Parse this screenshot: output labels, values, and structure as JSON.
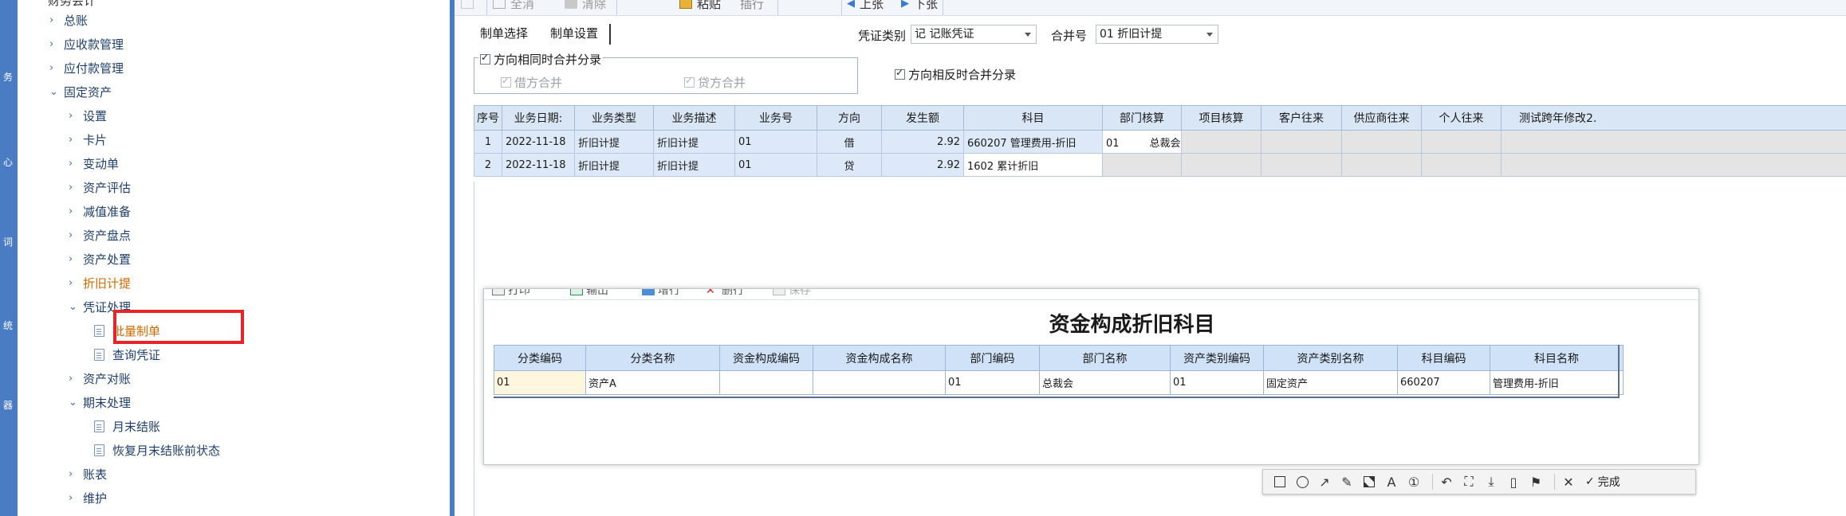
{
  "tree": {
    "top_partial": "财务会计",
    "items": [
      {
        "label": "总账"
      },
      {
        "label": "应收款管理"
      },
      {
        "label": "应付款管理"
      },
      {
        "label": "固定资产"
      },
      {
        "label": "设置"
      },
      {
        "label": "卡片"
      },
      {
        "label": "变动单"
      },
      {
        "label": "资产评估"
      },
      {
        "label": "减值准备"
      },
      {
        "label": "资产盘点"
      },
      {
        "label": "资产处置"
      },
      {
        "label": "折旧计提"
      },
      {
        "label": "凭证处理"
      },
      {
        "label": "批量制单"
      },
      {
        "label": "查询凭证"
      },
      {
        "label": "资产对账"
      },
      {
        "label": "期末处理"
      },
      {
        "label": "月末结账"
      },
      {
        "label": "恢复月末结账前状态"
      },
      {
        "label": "账表"
      },
      {
        "label": "维护"
      }
    ],
    "highlight_color": "#e5252a",
    "active_color": "#cc6a00"
  },
  "toolbar": {
    "select_all": "全消",
    "clear": "清除",
    "paste": "粘贴",
    "insert": "插行",
    "prev": "上张",
    "next": "下张"
  },
  "tabs": [
    {
      "label": "制单选择"
    },
    {
      "label": "制单设置"
    }
  ],
  "form": {
    "voucher_type_label": "凭证类别",
    "voucher_type_value": "记 记账凭证",
    "merge_no_label": "合并号",
    "merge_no_value": "01  折旧计提",
    "same_dir_merge": "方向相同时合并分录",
    "debit_merge": "借方合并",
    "credit_merge": "贷方合并",
    "opposite_dir_merge": "方向相反时合并分录"
  },
  "grid": {
    "columns": [
      "序号",
      "业务日期:",
      "业务类型",
      "业务描述",
      "业务号",
      "方向",
      "发生额",
      "科目",
      "部门核算",
      "项目核算",
      "客户往来",
      "供应商往来",
      "个人往来",
      "测试跨年修改2."
    ],
    "rows": [
      {
        "seq": "1",
        "date": "2022-11-18",
        "type": "折旧计提",
        "desc": "折旧计提",
        "biz_no": "01",
        "dir": "借",
        "amount": "2.92",
        "subject": "660207  管理费用-折旧",
        "dept_code": "01",
        "dept_name": "总裁会"
      },
      {
        "seq": "2",
        "date": "2022-11-18",
        "type": "折旧计提",
        "desc": "折旧计提",
        "biz_no": "01",
        "dir": "贷",
        "amount": "2.92",
        "subject": "1602  累计折旧",
        "dept_code": "",
        "dept_name": ""
      }
    ]
  },
  "popup": {
    "toolbar": {
      "print": "打印",
      "export": "输出",
      "add_row": "增行",
      "del_row": "删行",
      "save": "保存"
    },
    "title": "资金构成折旧科目",
    "columns": [
      "分类编码",
      "分类名称",
      "资金构成编码",
      "资金构成名称",
      "部门编码",
      "部门名称",
      "资产类别编码",
      "资产类别名称",
      "科目编码",
      "科目名称"
    ],
    "rows": [
      [
        "01",
        "资产A",
        "",
        "",
        "01",
        "总裁会",
        "01",
        "固定资产",
        "660207",
        "管理费用-折旧"
      ]
    ]
  },
  "snip": {
    "done_label": "完成"
  }
}
